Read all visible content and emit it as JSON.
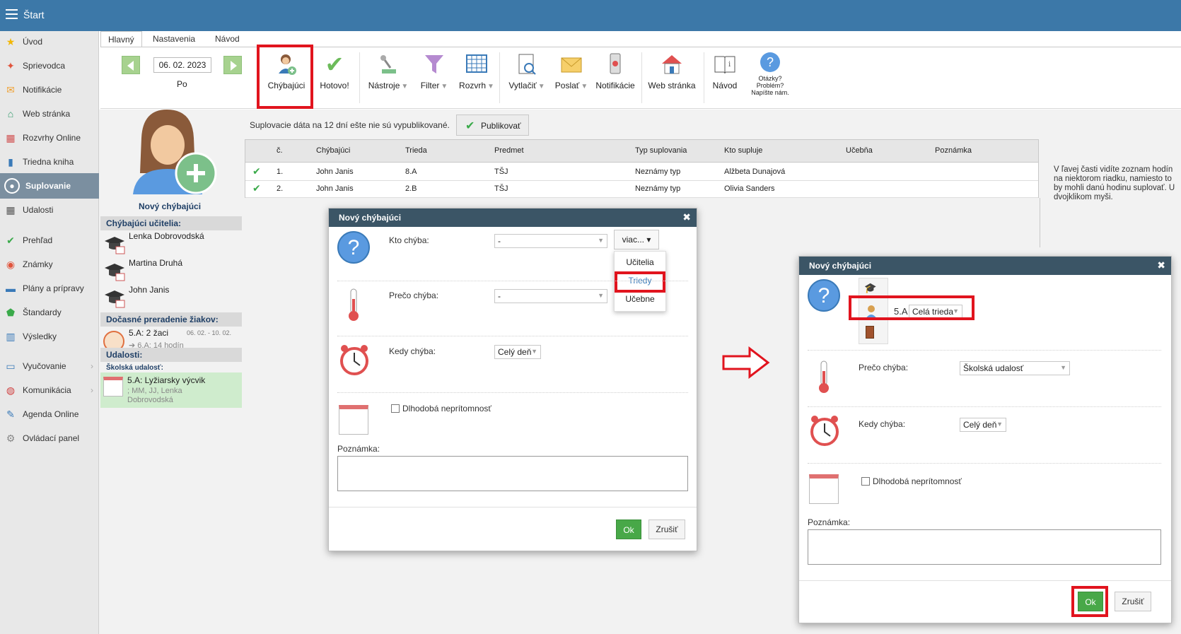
{
  "app": {
    "title": "Štart"
  },
  "sidebar": {
    "items": [
      {
        "label": "Úvod",
        "icon": "star-icon"
      },
      {
        "label": "Sprievodca",
        "icon": "wand-icon"
      },
      {
        "label": "Notifikácie",
        "icon": "envelope-icon"
      },
      {
        "label": "Web stránka",
        "icon": "house-icon"
      },
      {
        "label": "Rozvrhy Online",
        "icon": "timetable-icon"
      },
      {
        "label": "Triedna kniha",
        "icon": "book-icon"
      },
      {
        "label": "Suplovanie",
        "icon": "user-icon"
      },
      {
        "label": "Udalosti",
        "icon": "calendar-icon"
      },
      {
        "label": "Prehľad",
        "icon": "check-circle-icon"
      },
      {
        "label": "Známky",
        "icon": "grades-icon"
      },
      {
        "label": "Plány a prípravy",
        "icon": "briefcase-icon"
      },
      {
        "label": "Štandardy",
        "icon": "shield-icon"
      },
      {
        "label": "Výsledky",
        "icon": "bar-chart-icon"
      },
      {
        "label": "Vyučovanie",
        "icon": "open-book-icon"
      },
      {
        "label": "Komunikácia",
        "icon": "chat-icon"
      },
      {
        "label": "Agenda Online",
        "icon": "pen-icon"
      },
      {
        "label": "Ovládací panel",
        "icon": "gear-icon"
      }
    ]
  },
  "tabs": [
    "Hlavný",
    "Nastavenia",
    "Návod"
  ],
  "ribbon": {
    "date": "06. 02. 2023",
    "day": "Po",
    "buttons": {
      "chybajuci": "Chýbajúci",
      "hotovo": "Hotovo!",
      "nastroje": "Nástroje",
      "filter": "Filter",
      "rozvrh": "Rozvrh",
      "vytlacit": "Vytlačiť",
      "poslat": "Poslať",
      "notifikacie": "Notifikácie",
      "web": "Web stránka",
      "navod": "Návod",
      "otazky1": "Otázky?",
      "otazky2": "Problém?",
      "otazky3": "Napíšte nám."
    }
  },
  "left_panel": {
    "new_absent": "Nový chýbajúci",
    "absent_teachers_header": "Chýbajúci učitelia:",
    "teachers": [
      "Lenka Dobrovodská",
      "Martina Druhá",
      "John Janis"
    ],
    "reassign_header": "Dočasné preradenie žiakov:",
    "reassign_line1": "5.A: 2 žaci",
    "reassign_dates": "06. 02. - 10. 02.",
    "reassign_line2": "➔ 6.A: 14 hodín",
    "events_header": "Udalosti:",
    "school_event_label": "Školská udalosť:",
    "event_title": "5.A: Lyžiarsky výcvik",
    "event_detail1": "; MM, JJ, Lenka",
    "event_detail2": "Dobrovodská"
  },
  "main": {
    "publish_note": "Suplovacie dáta na 12 dní ešte nie sú vypublikované.",
    "publish_button": "Publikovať",
    "table": {
      "headers": [
        "č.",
        "Chýbajúci",
        "Trieda",
        "Predmet",
        "Typ suplovania",
        "Kto supluje",
        "Učebňa",
        "Poznámka"
      ],
      "rows": [
        [
          "1.",
          "John Janis",
          "8.A",
          "TŠJ",
          "Neznámy typ",
          "Alžbeta Dunajová",
          "",
          ""
        ],
        [
          "2.",
          "John Janis",
          "2.B",
          "TŠJ",
          "Neznámy typ",
          "Olivia Sanders",
          "",
          ""
        ]
      ]
    },
    "help_lines": [
      "V ľavej časti vidíte zoznam hodín",
      "na niektorom riadku, namiesto to",
      "by mohli danú hodinu suplovať. U",
      "dvojklikom myši."
    ]
  },
  "dialog1": {
    "title": "Nový chýbajúci",
    "who_label": "Kto chýba:",
    "who_value": "-",
    "more_button": "viac... ▾",
    "more_options": [
      "Učitelia",
      "Triedy",
      "Učebne"
    ],
    "why_label": "Prečo chýba:",
    "why_value": "-",
    "when_label": "Kedy chýba:",
    "when_value": "Celý deň",
    "longterm_label": "Dlhodobá neprítomnosť",
    "note_label": "Poznámka:",
    "ok": "Ok",
    "cancel": "Zrušiť"
  },
  "dialog2": {
    "title": "Nový chýbajúci",
    "class_value": "5.A",
    "class_scope": "Celá trieda",
    "why_label": "Prečo chýba:",
    "why_value": "Školská udalosť",
    "when_label": "Kedy chýba:",
    "when_value": "Celý deň",
    "longterm_label": "Dlhodobá neprítomnosť",
    "note_label": "Poznámka:",
    "ok": "Ok",
    "cancel": "Zrušiť"
  },
  "colors": {
    "topbar": "#3c78a8",
    "highlight_red": "#e1141e",
    "ok_green": "#48a848",
    "dialog_header": "#3b5566"
  }
}
